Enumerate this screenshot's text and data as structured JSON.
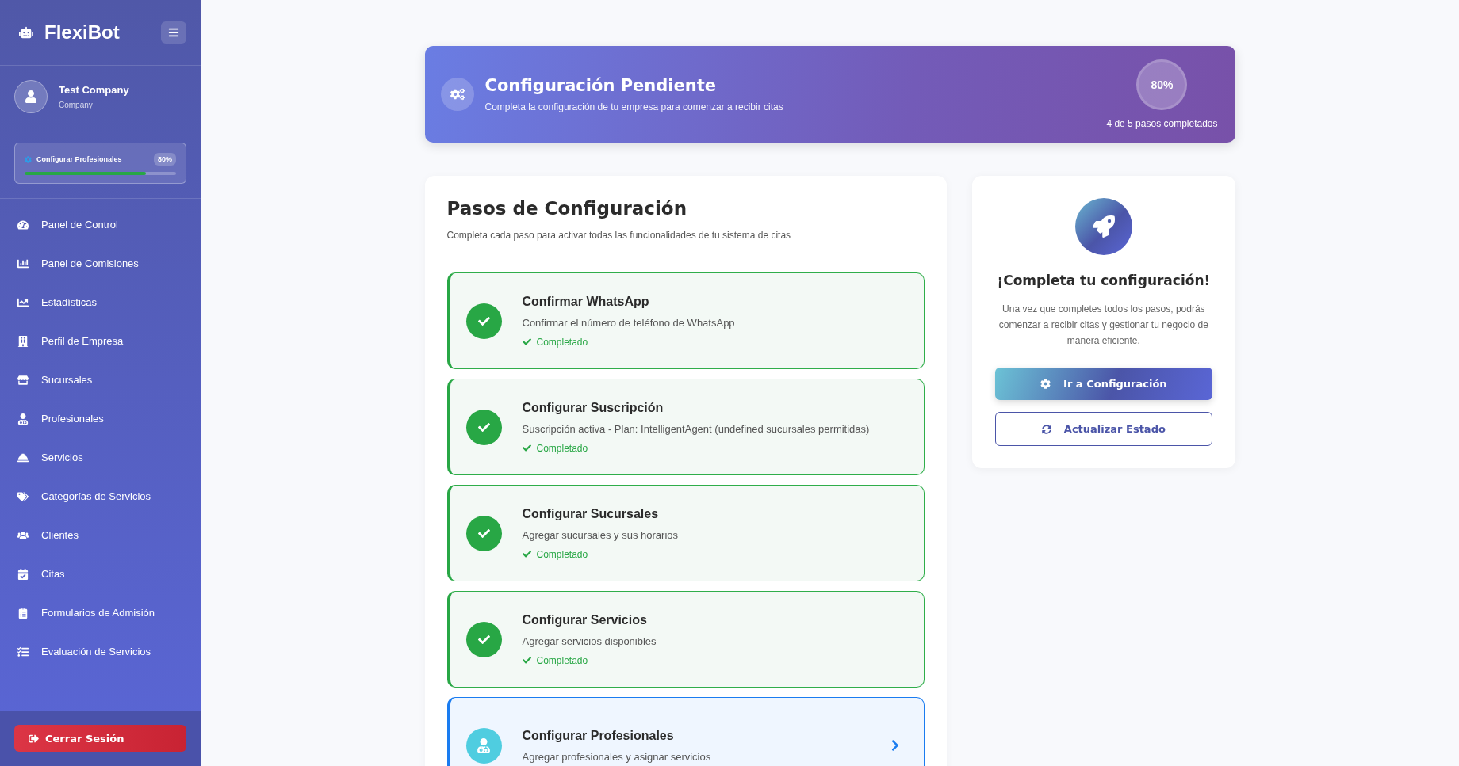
{
  "sidebar": {
    "brand": "FlexiBot",
    "user": {
      "name": "Test Company",
      "role": "Company"
    },
    "progress": {
      "label": "Configurar Profesionales",
      "percent": "80%",
      "level": 0.8
    },
    "items": [
      {
        "label": "Panel de Control"
      },
      {
        "label": "Panel de Comisiones"
      },
      {
        "label": "Estadísticas"
      },
      {
        "label": "Perfil de Empresa"
      },
      {
        "label": "Sucursales"
      },
      {
        "label": "Profesionales"
      },
      {
        "label": "Servicios"
      },
      {
        "label": "Categorías de Servicios"
      },
      {
        "label": "Clientes"
      },
      {
        "label": "Citas"
      },
      {
        "label": "Formularios de Admisión"
      },
      {
        "label": "Evaluación de Servicios"
      }
    ],
    "logout": "Cerrar Sesión"
  },
  "banner": {
    "title": "Configuración Pendiente",
    "subtitle": "Completa la configuración de tu empresa para comenzar a recibir citas",
    "percent": "80%",
    "steps_text": "4 de 5 pasos completados"
  },
  "steps": {
    "title": "Pasos de Configuración",
    "subtitle": "Completa cada paso para activar todas las funcionalidades de tu sistema de citas",
    "items": [
      {
        "title": "Confirmar WhatsApp",
        "description": "Confirmar el número de teléfono de WhatsApp",
        "done": true,
        "status_text": "Completado"
      },
      {
        "title": "Configurar Suscripción",
        "description": "Suscripción activa - Plan: IntelligentAgent (undefined sucursales permitidas)",
        "done": true,
        "status_text": "Completado"
      },
      {
        "title": "Configurar Sucursales",
        "description": "Agregar sucursales y sus horarios",
        "done": true,
        "status_text": "Completado"
      },
      {
        "title": "Configurar Servicios",
        "description": "Agregar servicios disponibles",
        "done": true,
        "status_text": "Completado"
      },
      {
        "title": "Configurar Profesionales",
        "description": "Agregar profesionales y asignar servicios",
        "done": false
      }
    ]
  },
  "cta": {
    "title": "¡Completa tu configuración!",
    "text": "Una vez que completes todos los pasos, podrás comenzar a recibir citas y gestionar tu negocio de manera eficiente.",
    "primary": "Ir a Configuración",
    "secondary": "Actualizar Estado"
  }
}
